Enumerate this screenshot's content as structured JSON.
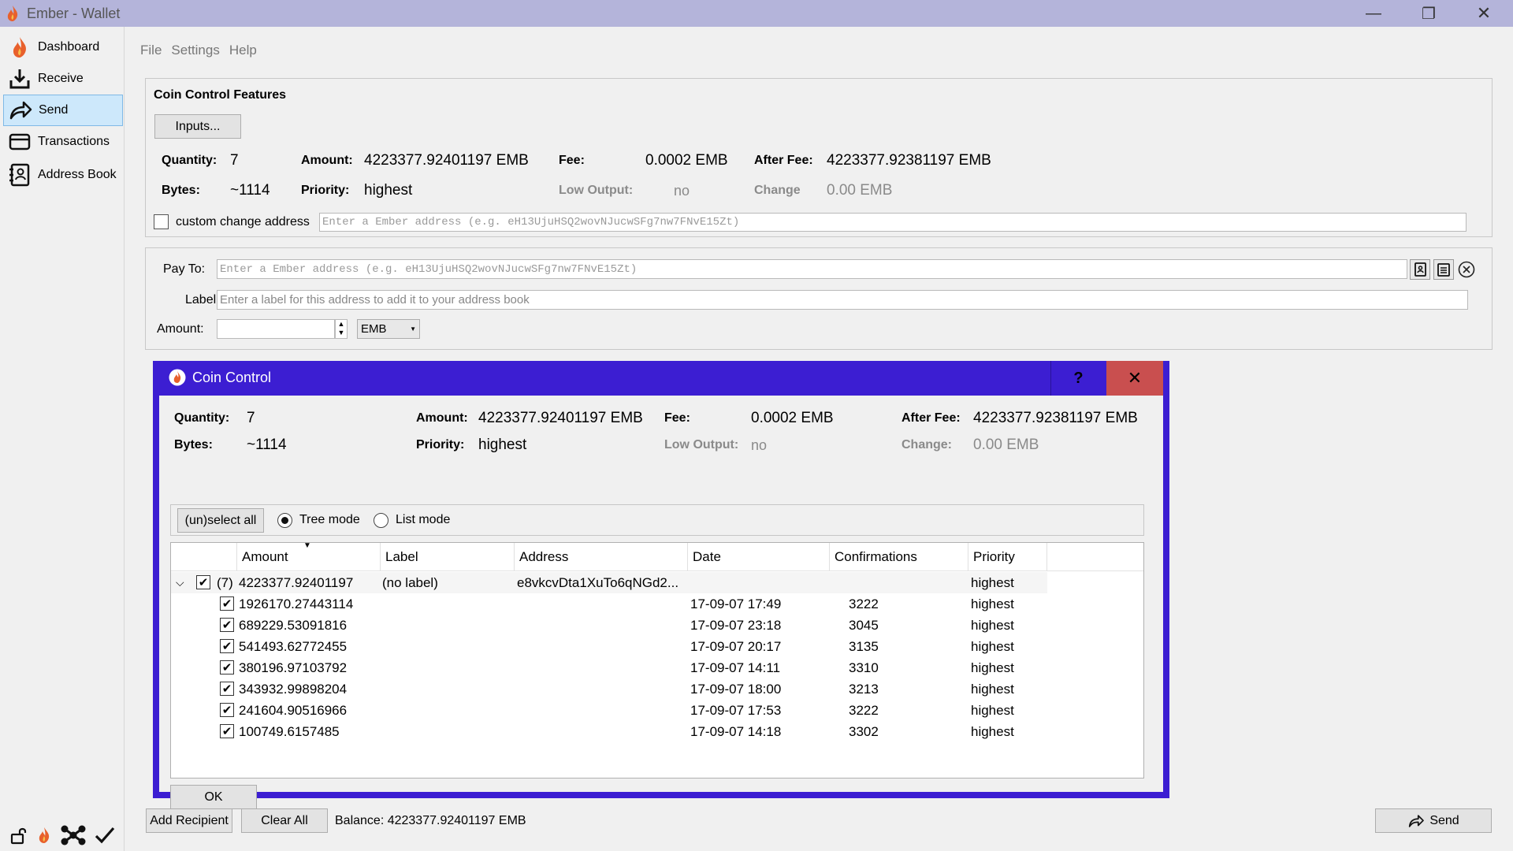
{
  "window": {
    "title": "Ember - Wallet",
    "minimize": "—",
    "maximize": "❐",
    "close": "✕"
  },
  "sidebar": {
    "items": [
      {
        "label": "Dashboard",
        "icon": "flame-icon"
      },
      {
        "label": "Receive",
        "icon": "receive-icon"
      },
      {
        "label": "Send",
        "icon": "send-arrow-icon",
        "active": true
      },
      {
        "label": "Transactions",
        "icon": "card-icon"
      },
      {
        "label": "Address Book",
        "icon": "address-book-icon"
      }
    ]
  },
  "menu": {
    "file": "File",
    "settings": "Settings",
    "help": "Help"
  },
  "coin_control_features": {
    "title": "Coin Control Features",
    "inputs_button": "Inputs...",
    "quantity_label": "Quantity:",
    "quantity_value": "7",
    "amount_label": "Amount:",
    "amount_value": "4223377.92401197 EMB",
    "fee_label": "Fee:",
    "fee_value": "0.0002 EMB",
    "after_fee_label": "After Fee:",
    "after_fee_value": "4223377.92381197 EMB",
    "bytes_label": "Bytes:",
    "bytes_value": "~1114",
    "priority_label": "Priority:",
    "priority_value": "highest",
    "low_output_label": "Low Output:",
    "low_output_value": "no",
    "change_label": "Change",
    "change_value": "0.00 EMB",
    "custom_change_label": "custom change address",
    "custom_change_placeholder": "Enter a Ember address (e.g. eH13UjuHSQ2wovNJucwSFg7nw7FNvE15Zt)"
  },
  "recipient": {
    "pay_to_label": "Pay To:",
    "pay_to_placeholder": "Enter a Ember address (e.g. eH13UjuHSQ2wovNJucwSFg7nw7FNvE15Zt)",
    "label_label": "Label:",
    "label_placeholder": "Enter a label for this address to add it to your address book",
    "amount_label": "Amount:",
    "unit": "EMB"
  },
  "dialog": {
    "title": "Coin Control",
    "help": "?",
    "close": "✕",
    "quantity_label": "Quantity:",
    "quantity_value": "7",
    "amount_label": "Amount:",
    "amount_value": "4223377.92401197 EMB",
    "fee_label": "Fee:",
    "fee_value": "0.0002 EMB",
    "after_fee_label": "After Fee:",
    "after_fee_value": "4223377.92381197 EMB",
    "bytes_label": "Bytes:",
    "bytes_value": "~1114",
    "priority_label": "Priority:",
    "priority_value": "highest",
    "low_output_label": "Low Output:",
    "low_output_value": "no",
    "change_label": "Change:",
    "change_value": "0.00 EMB",
    "select_all": "(un)select all",
    "tree_mode": "Tree mode",
    "list_mode": "List mode",
    "ok": "OK",
    "columns": [
      "Amount",
      "Label",
      "Address",
      "Date",
      "Confirmations",
      "Priority"
    ],
    "parent": {
      "count": "(7)",
      "amount": "4223377.92401197",
      "label": "(no label)",
      "address": "e8vkcvDta1XuTo6qNGd2...",
      "priority": "highest"
    },
    "rows": [
      {
        "amount": "1926170.27443114",
        "date": "17-09-07 17:49",
        "confirmations": "3222",
        "priority": "highest"
      },
      {
        "amount": "689229.53091816",
        "date": "17-09-07 23:18",
        "confirmations": "3045",
        "priority": "highest"
      },
      {
        "amount": "541493.62772455",
        "date": "17-09-07 20:17",
        "confirmations": "3135",
        "priority": "highest"
      },
      {
        "amount": "380196.97103792",
        "date": "17-09-07 14:11",
        "confirmations": "3310",
        "priority": "highest"
      },
      {
        "amount": "343932.99898204",
        "date": "17-09-07 18:00",
        "confirmations": "3213",
        "priority": "highest"
      },
      {
        "amount": "241604.90516966",
        "date": "17-09-07 17:53",
        "confirmations": "3222",
        "priority": "highest"
      },
      {
        "amount": "100749.6157485",
        "date": "17-09-07 14:18",
        "confirmations": "3302",
        "priority": "highest"
      }
    ]
  },
  "bottom": {
    "add_recipient": "Add Recipient",
    "clear_all": "Clear All",
    "balance": "Balance: 4223377.92401197 EMB",
    "send": "Send"
  },
  "colors": {
    "titlebar": "#b4b4da",
    "dialog_frame": "#3c1ed2",
    "close_button": "#c94f4f",
    "active_nav": "#cde8fb",
    "flame": "#e8602c"
  }
}
